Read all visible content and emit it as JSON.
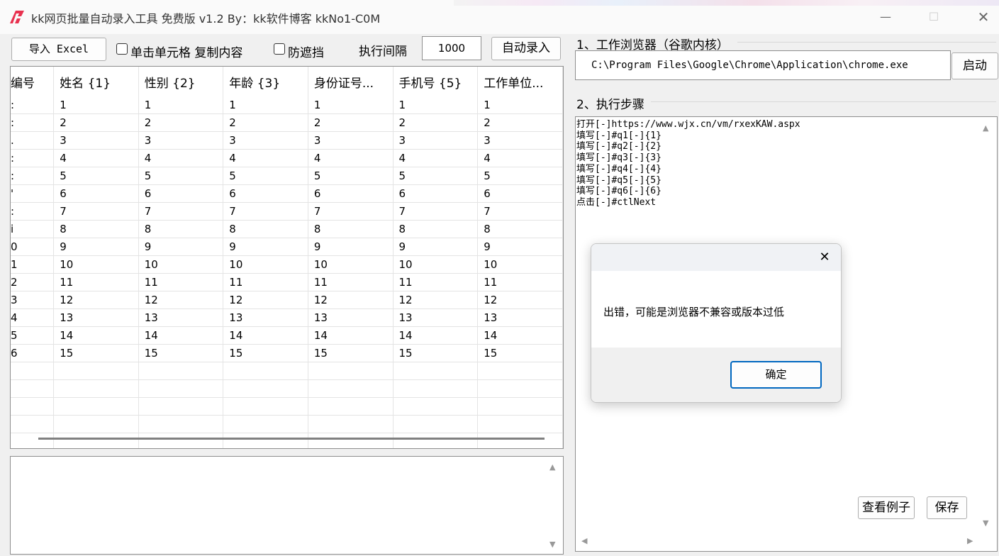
{
  "window": {
    "title": "kk网页批量自动录入工具 免费版  v1.2   By：kk软件博客 kkNo1-C0M",
    "minimize_glyph": "—",
    "maximize_glyph": "☐",
    "close_glyph": "✕"
  },
  "toolbar": {
    "import_label": "导入 Excel",
    "click_copy_label": "单击单元格 复制内容",
    "anti_block_label": "防遮挡",
    "interval_label": "执行间隔",
    "interval_value": "1000",
    "auto_fill_label": "自动录入"
  },
  "grid": {
    "columns": [
      "编号",
      "姓名 {1}",
      "性别 {2}",
      "年龄 {3}",
      "身份证号...",
      "手机号 {5}",
      "工作单位..."
    ],
    "rows": [
      [
        ":",
        "1",
        "1",
        "1",
        "1",
        "1",
        "1"
      ],
      [
        ":",
        "2",
        "2",
        "2",
        "2",
        "2",
        "2"
      ],
      [
        ".",
        "3",
        "3",
        "3",
        "3",
        "3",
        "3"
      ],
      [
        ":",
        "4",
        "4",
        "4",
        "4",
        "4",
        "4"
      ],
      [
        ":",
        "5",
        "5",
        "5",
        "5",
        "5",
        "5"
      ],
      [
        "'",
        "6",
        "6",
        "6",
        "6",
        "6",
        "6"
      ],
      [
        ":",
        "7",
        "7",
        "7",
        "7",
        "7",
        "7"
      ],
      [
        "i",
        "8",
        "8",
        "8",
        "8",
        "8",
        "8"
      ],
      [
        "0",
        "9",
        "9",
        "9",
        "9",
        "9",
        "9"
      ],
      [
        "1",
        "10",
        "10",
        "10",
        "10",
        "10",
        "10"
      ],
      [
        "2",
        "11",
        "11",
        "11",
        "11",
        "11",
        "11"
      ],
      [
        "3",
        "12",
        "12",
        "12",
        "12",
        "12",
        "12"
      ],
      [
        "4",
        "13",
        "13",
        "13",
        "13",
        "13",
        "13"
      ],
      [
        "5",
        "14",
        "14",
        "14",
        "14",
        "14",
        "14"
      ],
      [
        "6",
        "15",
        "15",
        "15",
        "15",
        "15",
        "15"
      ]
    ],
    "empty_rows": 5
  },
  "browser_section": {
    "label": "1、工作浏览器（谷歌内核）",
    "path": "C:\\Program Files\\Google\\Chrome\\Application\\chrome.exe",
    "launch_label": "启动"
  },
  "steps_section": {
    "label": "2、执行步骤",
    "text": "打开[-]https://www.wjx.cn/vm/rxexKAW.aspx\n填写[-]#q1[-]{1}\n填写[-]#q2[-]{2}\n填写[-]#q3[-]{3}\n填写[-]#q4[-]{4}\n填写[-]#q5[-]{5}\n填写[-]#q6[-]{6}\n点击[-]#ctlNext",
    "example_label": "查看例子",
    "save_label": "保存"
  },
  "dialog": {
    "message": "出错，可能是浏览器不兼容或版本过低",
    "ok_label": "确定",
    "close_glyph": "✕"
  },
  "colors": {
    "accent": "#0067c0",
    "logo": "#e8314f",
    "window_bg": "#f0f0f0"
  },
  "icons": {
    "app": "kk-logo-icon",
    "scroll_up": "▲",
    "scroll_down": "▼",
    "scroll_left": "◀",
    "scroll_right": "▶"
  }
}
